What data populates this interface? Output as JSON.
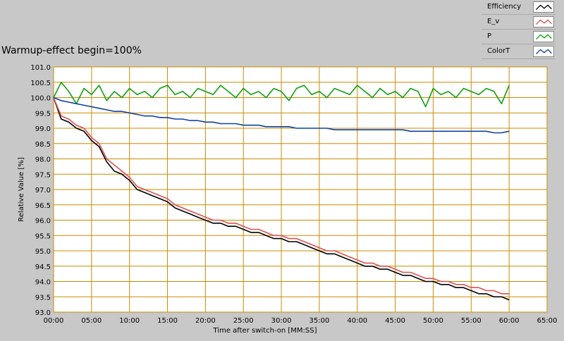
{
  "chart_data": {
    "type": "line",
    "title": "Warmup-effect begin=100%",
    "xlabel": "Time after switch-on [MM:SS]",
    "ylabel": "Relative Value [%]",
    "x_unit": "minutes",
    "xlim": [
      0,
      65
    ],
    "ylim": [
      93.0,
      101.0
    ],
    "x_ticks": [
      "00:00",
      "05:00",
      "10:00",
      "15:00",
      "20:00",
      "25:00",
      "30:00",
      "35:00",
      "40:00",
      "45:00",
      "50:00",
      "55:00",
      "60:00",
      "65:00"
    ],
    "y_ticks": [
      "101.0",
      "100.5",
      "100.0",
      "99.5",
      "99.0",
      "98.5",
      "98.0",
      "97.5",
      "97.0",
      "96.5",
      "96.0",
      "95.5",
      "95.0",
      "94.5",
      "94.0",
      "93.5",
      "93.0"
    ],
    "grid": true,
    "legend_position": "top-right",
    "background": "#ffffff",
    "grid_color": "#c88c00",
    "series": [
      {
        "name": "Efficiency",
        "color": "#000000",
        "x": [
          0,
          1,
          2,
          3,
          4,
          5,
          6,
          7,
          8,
          9,
          10,
          11,
          12,
          13,
          14,
          15,
          16,
          17,
          18,
          19,
          20,
          21,
          22,
          23,
          24,
          25,
          26,
          27,
          28,
          29,
          30,
          31,
          32,
          33,
          34,
          35,
          36,
          37,
          38,
          39,
          40,
          41,
          42,
          43,
          44,
          45,
          46,
          47,
          48,
          49,
          50,
          51,
          52,
          53,
          54,
          55,
          56,
          57,
          58,
          59,
          60
        ],
        "y": [
          100.0,
          99.3,
          99.2,
          99.0,
          98.9,
          98.6,
          98.4,
          97.9,
          97.6,
          97.5,
          97.3,
          97.0,
          96.9,
          96.8,
          96.7,
          96.6,
          96.4,
          96.3,
          96.2,
          96.1,
          96.0,
          95.9,
          95.9,
          95.8,
          95.8,
          95.7,
          95.6,
          95.6,
          95.5,
          95.4,
          95.4,
          95.3,
          95.3,
          95.2,
          95.1,
          95.0,
          94.9,
          94.9,
          94.8,
          94.7,
          94.6,
          94.5,
          94.5,
          94.4,
          94.4,
          94.3,
          94.2,
          94.2,
          94.1,
          94.0,
          94.0,
          93.9,
          93.9,
          93.8,
          93.8,
          93.7,
          93.6,
          93.6,
          93.5,
          93.5,
          93.4
        ]
      },
      {
        "name": "E_v",
        "color": "#e05050",
        "x": [
          0,
          1,
          2,
          3,
          4,
          5,
          6,
          7,
          8,
          9,
          10,
          11,
          12,
          13,
          14,
          15,
          16,
          17,
          18,
          19,
          20,
          21,
          22,
          23,
          24,
          25,
          26,
          27,
          28,
          29,
          30,
          31,
          32,
          33,
          34,
          35,
          36,
          37,
          38,
          39,
          40,
          41,
          42,
          43,
          44,
          45,
          46,
          47,
          48,
          49,
          50,
          51,
          52,
          53,
          54,
          55,
          56,
          57,
          58,
          59,
          60
        ],
        "y": [
          100.0,
          99.4,
          99.3,
          99.1,
          99.0,
          98.7,
          98.5,
          98.0,
          97.8,
          97.6,
          97.4,
          97.1,
          97.0,
          96.9,
          96.8,
          96.7,
          96.5,
          96.4,
          96.3,
          96.2,
          96.1,
          96.0,
          96.0,
          95.9,
          95.9,
          95.8,
          95.7,
          95.7,
          95.6,
          95.5,
          95.5,
          95.4,
          95.4,
          95.3,
          95.2,
          95.1,
          95.0,
          95.0,
          94.9,
          94.8,
          94.7,
          94.6,
          94.6,
          94.5,
          94.5,
          94.4,
          94.3,
          94.3,
          94.2,
          94.1,
          94.1,
          94.0,
          94.0,
          93.9,
          93.9,
          93.8,
          93.8,
          93.7,
          93.7,
          93.6,
          93.6
        ]
      },
      {
        "name": "P",
        "color": "#10a010",
        "x": [
          0,
          1,
          2,
          3,
          4,
          5,
          6,
          7,
          8,
          9,
          10,
          11,
          12,
          13,
          14,
          15,
          16,
          17,
          18,
          19,
          20,
          21,
          22,
          23,
          24,
          25,
          26,
          27,
          28,
          29,
          30,
          31,
          32,
          33,
          34,
          35,
          36,
          37,
          38,
          39,
          40,
          41,
          42,
          43,
          44,
          45,
          46,
          47,
          48,
          49,
          50,
          51,
          52,
          53,
          54,
          55,
          56,
          57,
          58,
          59,
          60
        ],
        "y": [
          100.0,
          100.5,
          100.2,
          99.8,
          100.3,
          100.1,
          100.4,
          99.9,
          100.2,
          100.0,
          100.3,
          100.1,
          100.2,
          100.0,
          100.3,
          100.4,
          100.1,
          100.2,
          100.0,
          100.3,
          100.2,
          100.1,
          100.4,
          100.2,
          100.0,
          100.3,
          100.1,
          100.2,
          100.0,
          100.3,
          100.2,
          99.9,
          100.3,
          100.4,
          100.1,
          100.2,
          100.0,
          100.3,
          100.2,
          100.1,
          100.4,
          100.2,
          100.0,
          100.3,
          100.1,
          100.2,
          100.0,
          100.3,
          100.2,
          99.7,
          100.3,
          100.1,
          100.2,
          100.0,
          100.3,
          100.2,
          100.1,
          100.3,
          100.2,
          99.8,
          100.4
        ]
      },
      {
        "name": "ColorT",
        "color": "#1040a0",
        "x": [
          0,
          1,
          2,
          3,
          4,
          5,
          6,
          7,
          8,
          9,
          10,
          11,
          12,
          13,
          14,
          15,
          16,
          17,
          18,
          19,
          20,
          21,
          22,
          23,
          24,
          25,
          26,
          27,
          28,
          29,
          30,
          31,
          32,
          33,
          34,
          35,
          36,
          37,
          38,
          39,
          40,
          41,
          42,
          43,
          44,
          45,
          46,
          47,
          48,
          49,
          50,
          51,
          52,
          53,
          54,
          55,
          56,
          57,
          58,
          59,
          60
        ],
        "y": [
          100.0,
          99.9,
          99.85,
          99.8,
          99.75,
          99.7,
          99.65,
          99.6,
          99.55,
          99.55,
          99.5,
          99.45,
          99.4,
          99.4,
          99.35,
          99.35,
          99.3,
          99.3,
          99.25,
          99.25,
          99.2,
          99.2,
          99.15,
          99.15,
          99.15,
          99.1,
          99.1,
          99.1,
          99.05,
          99.05,
          99.05,
          99.05,
          99.0,
          99.0,
          99.0,
          99.0,
          99.0,
          98.95,
          98.95,
          98.95,
          98.95,
          98.95,
          98.95,
          98.95,
          98.95,
          98.95,
          98.95,
          98.9,
          98.9,
          98.9,
          98.9,
          98.9,
          98.9,
          98.9,
          98.9,
          98.9,
          98.9,
          98.9,
          98.85,
          98.85,
          98.9
        ]
      }
    ]
  }
}
